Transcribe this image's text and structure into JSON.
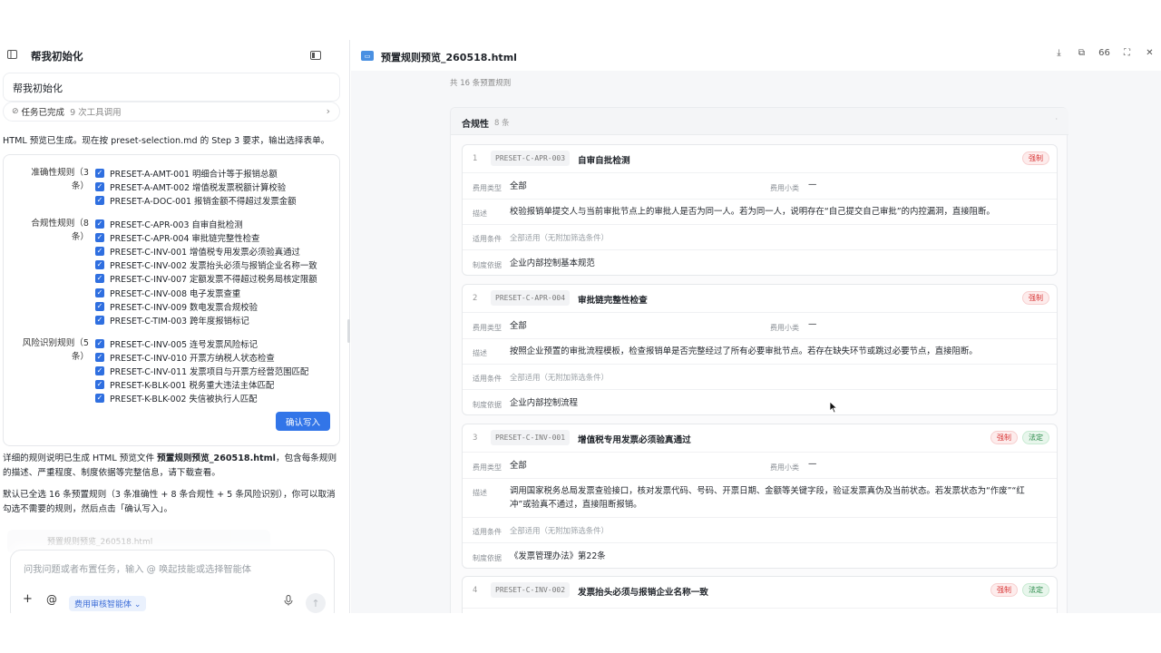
{
  "left": {
    "title": "帮我初始化",
    "user_message": "帮我初始化",
    "task_status": "任务已完成",
    "task_calls": "9 次工具调用",
    "intro": "HTML 预览已生成。现在按 preset-selection.md 的 Step 3 要求，输出选择表单。",
    "groups": [
      {
        "label_line1": "准确性规则（3",
        "label_line2": "条）",
        "items": [
          "PRESET-A-AMT-001 明细合计等于报销总额",
          "PRESET-A-AMT-002 增值税发票税额计算校验",
          "PRESET-A-DOC-001 报销金额不得超过发票金额"
        ]
      },
      {
        "label_line1": "合规性规则（8",
        "label_line2": "条）",
        "items": [
          "PRESET-C-APR-003 自审自批检测",
          "PRESET-C-APR-004 审批链完整性检查",
          "PRESET-C-INV-001 增值税专用发票必须验真通过",
          "PRESET-C-INV-002 发票抬头必须与报销企业名称一致",
          "PRESET-C-INV-007 定额发票不得超过税务局核定限额",
          "PRESET-C-INV-008 电子发票查重",
          "PRESET-C-INV-009 数电发票合规校验",
          "PRESET-C-TIM-003 跨年度报销标记"
        ]
      },
      {
        "label_line1": "风险识别规则（5",
        "label_line2": "条）",
        "items": [
          "PRESET-C-INV-005 连号发票风险标记",
          "PRESET-C-INV-010 开票方纳税人状态检查",
          "PRESET-C-INV-011 发票项目与开票方经营范围匹配",
          "PRESET-K-BLK-001 税务重大违法主体匹配",
          "PRESET-K-BLK-002 失信被执行人匹配"
        ]
      }
    ],
    "confirm_label": "确认写入",
    "summary_pre": "详细的规则说明已生成 HTML 预览文件 ",
    "summary_file": "预置规则预览_260518.html",
    "summary_post": "，包含每条规则的描述、严重程度、制度依据等完整信息，请下载查看。",
    "default_text": "默认已全选 16 条预置规则（3 条准确性 + 8 条合规性 + 5 条风险识别），你可以取消勾选不需要的规则，然后点击「确认写入」。",
    "file_chip": "预置规则预览_260518.html",
    "input_placeholder": "问我问题或者布置任务，输入 @ 唤起技能或选择智能体",
    "agent_label": "费用审核智能体 ⌄"
  },
  "right": {
    "file_title": "预置规则预览_260518.html",
    "zoom_label": "66",
    "count_text": "共 16 条预置规则",
    "section_title": "合规性",
    "section_count": "8 条",
    "labels": {
      "fee_type": "费用类型",
      "fee_sub": "费用小类",
      "desc": "描述",
      "cond": "适用条件",
      "basis": "制度依据"
    },
    "rules": [
      {
        "idx": "1",
        "code": "PRESET-C-APR-003",
        "name": "自审自批检测",
        "badges": [
          {
            "text": "强制",
            "kind": "red"
          }
        ],
        "fee_type": "全部",
        "fee_sub": "—",
        "desc_line1": "校验报销单提交人与当前审批节点上的审批人是否为同一人。若为同一人，说明存在“自己提交自己审批”的内控漏洞，直接阻断。",
        "desc_line2": "",
        "cond": "全部适用（无附加筛选条件）",
        "basis": "企业内部控制基本规范"
      },
      {
        "idx": "2",
        "code": "PRESET-C-APR-004",
        "name": "审批链完整性检查",
        "badges": [
          {
            "text": "强制",
            "kind": "red"
          }
        ],
        "fee_type": "全部",
        "fee_sub": "—",
        "desc_line1": "按照企业预置的审批流程模板，检查报销单是否完整经过了所有必要审批节点。若存在缺失环节或跳过必要节点，直接阻断。",
        "desc_line2": "",
        "cond": "全部适用（无附加筛选条件）",
        "basis": "企业内部控制流程"
      },
      {
        "idx": "3",
        "code": "PRESET-C-INV-001",
        "name": "增值税专用发票必须验真通过",
        "badges": [
          {
            "text": "强制",
            "kind": "red"
          },
          {
            "text": "法定",
            "kind": "green"
          }
        ],
        "fee_type": "全部",
        "fee_sub": "—",
        "desc_line1": "调用国家税务总局发票查验接口，核对发票代码、号码、开票日期、金额等关键字段，验证发票真伪及当前状态。若发票状态为“作废”“红",
        "desc_line2": "冲”或验真不通过，直接阻断报销。",
        "cond": "全部适用（无附加筛选条件）",
        "basis": "《发票管理办法》第22条"
      },
      {
        "idx": "4",
        "code": "PRESET-C-INV-002",
        "name": "发票抬头必须与报销企业名称一致",
        "badges": [
          {
            "text": "强制",
            "kind": "red"
          },
          {
            "text": "法定",
            "kind": "green"
          }
        ]
      }
    ]
  },
  "colors": {
    "accent": "#3275e8",
    "danger": "#d93838",
    "success": "#2a8a4a"
  }
}
